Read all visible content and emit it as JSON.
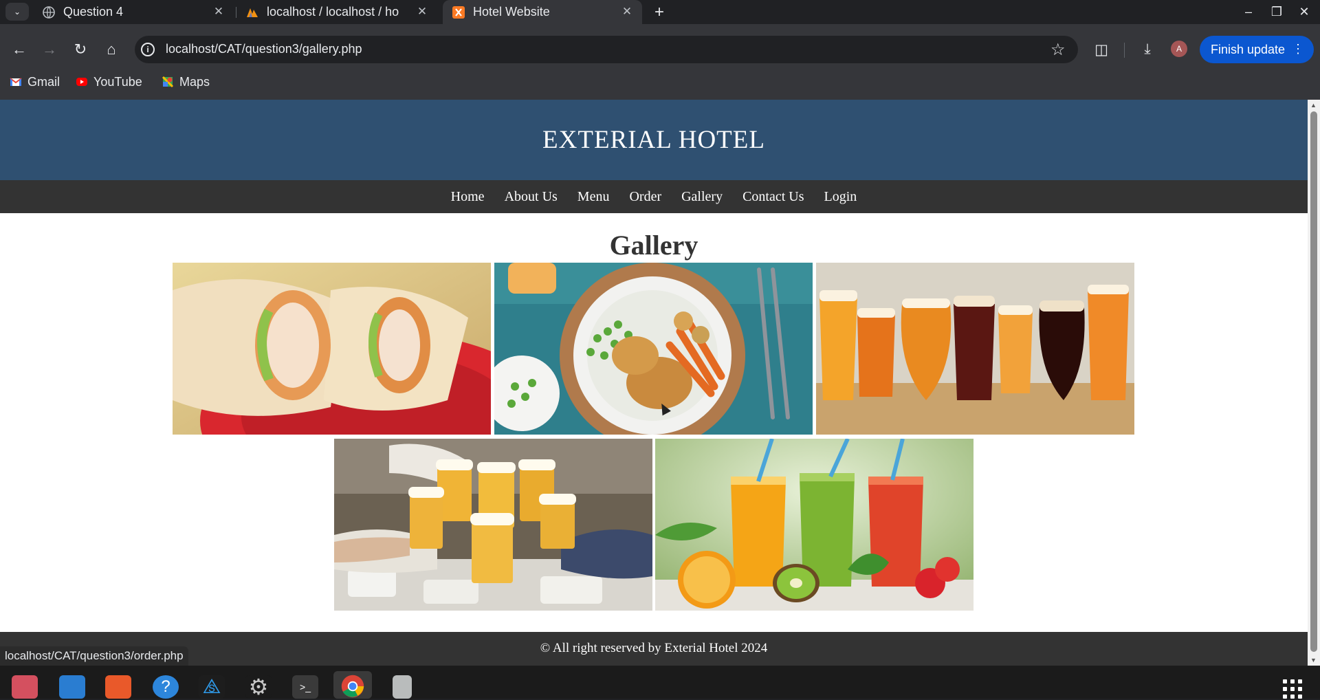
{
  "browser": {
    "tabs": [
      {
        "title": "Question 4",
        "favicon": "globe-icon",
        "active": false
      },
      {
        "title": "localhost / localhost / ho",
        "favicon": "phpmyadmin-icon",
        "active": false
      },
      {
        "title": "Hotel Website",
        "favicon": "xampp-icon",
        "active": true
      }
    ],
    "url": "localhost/CAT/question3/gallery.php",
    "finish_update_label": "Finish update",
    "profile_initial": "A",
    "bookmarks": [
      {
        "label": "Gmail",
        "icon": "gmail-icon",
        "color": "#ea4335"
      },
      {
        "label": "YouTube",
        "icon": "youtube-icon",
        "color": "#ff0000"
      },
      {
        "label": "Maps",
        "icon": "maps-icon",
        "color": "#34a853"
      }
    ],
    "status_url": "localhost/CAT/question3/order.php"
  },
  "site": {
    "hotel_name": "EXTERIAL HOTEL",
    "nav": [
      "Home",
      "About Us",
      "Menu",
      "Order",
      "Gallery",
      "Contact Us",
      "Login"
    ],
    "heading": "Gallery",
    "photos": [
      {
        "subject": "chicken-wrap-photo"
      },
      {
        "subject": "roast-chicken-plate-photo"
      },
      {
        "subject": "craft-beer-glasses-photo"
      },
      {
        "subject": "beer-toast-photo"
      },
      {
        "subject": "fruit-juice-glasses-photo"
      }
    ],
    "footer": "© All right reserved by Exterial Hotel 2024",
    "colors": {
      "header_bg": "#2f5071",
      "nav_bg": "#333333",
      "footer_bg": "#333333"
    }
  },
  "taskbar": {
    "apps": [
      "files-icon",
      "writer-icon",
      "app-center-icon",
      "help-icon",
      "vscode-icon",
      "settings-icon",
      "terminal-icon",
      "chrome-icon",
      "trash-icon"
    ]
  }
}
